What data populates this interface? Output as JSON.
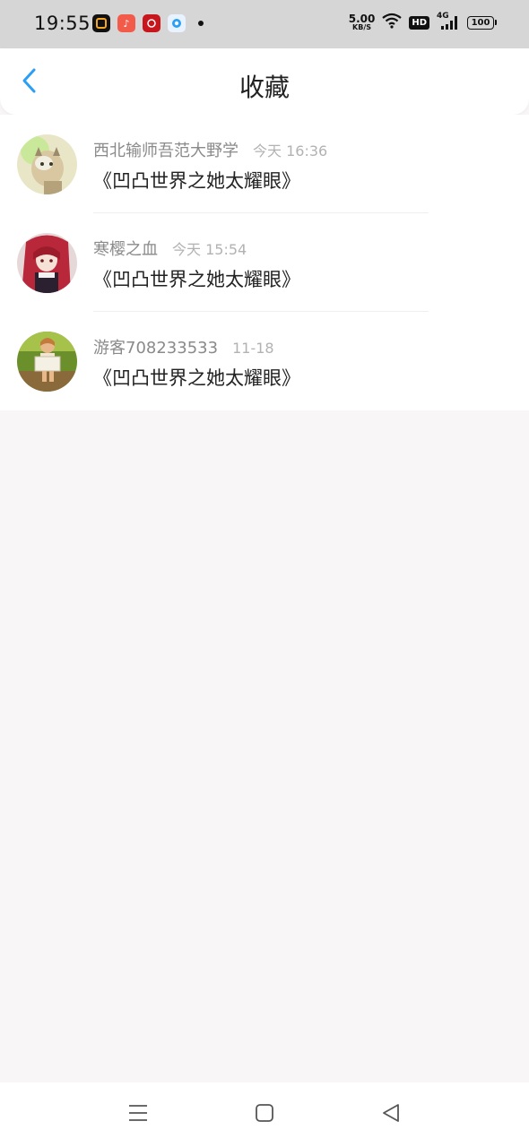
{
  "status_bar": {
    "time": "19:55",
    "net_speed_value": "5.00",
    "net_speed_unit": "KB/S",
    "hd_label": "HD",
    "network_label": "4G",
    "battery_level": "100",
    "notification_icons": [
      "app-icon-1",
      "music-icon",
      "app-icon-red",
      "app-icon-blue"
    ]
  },
  "header": {
    "title": "收藏",
    "back_icon": "chevron-left-icon",
    "accent_color": "#2a9ff5"
  },
  "favorites": [
    {
      "username": "西北输师吾范大野学",
      "time": "今天 16:36",
      "book_title": "《凹凸世界之她太耀眼》"
    },
    {
      "username": "寒樱之血",
      "time": "今天 15:54",
      "book_title": "《凹凸世界之她太耀眼》"
    },
    {
      "username": "游客708233533",
      "time": "11-18",
      "book_title": "《凹凸世界之她太耀眼》"
    }
  ],
  "bottom_nav": {
    "items": [
      "menu-icon",
      "home-icon",
      "back-icon"
    ]
  }
}
